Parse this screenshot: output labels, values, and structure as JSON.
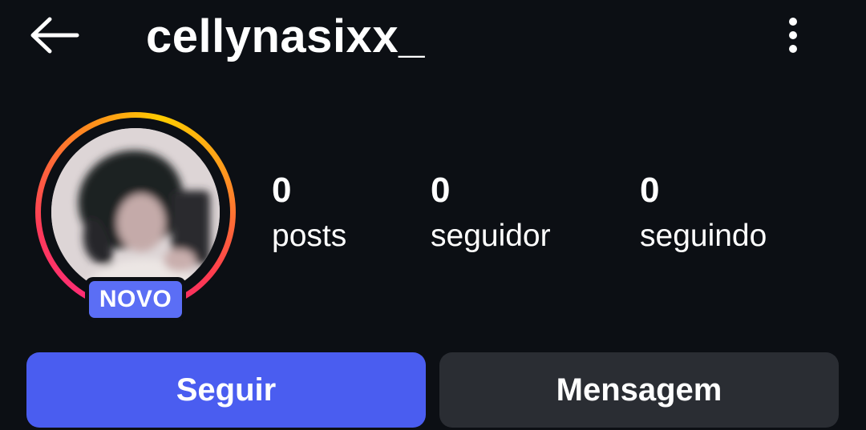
{
  "header": {
    "back_icon": "arrow-left-icon",
    "username": "cellynasixx_",
    "more_icon": "more-vertical-icon"
  },
  "profile": {
    "avatar": "profile-photo",
    "badge": "NOVO",
    "story_ring_colors": [
      "#ffcc00",
      "#ff8a1f",
      "#ff3a5a",
      "#e8158b"
    ]
  },
  "stats": {
    "posts": {
      "count": "0",
      "label": "posts"
    },
    "followers": {
      "count": "0",
      "label": "seguidor"
    },
    "following": {
      "count": "0",
      "label": "seguindo"
    }
  },
  "actions": {
    "follow_label": "Seguir",
    "message_label": "Mensagem"
  },
  "colors": {
    "background": "#0c0f14",
    "follow_button": "#4a5df0",
    "message_button": "#2a2d33",
    "badge": "#5b6ef5"
  }
}
